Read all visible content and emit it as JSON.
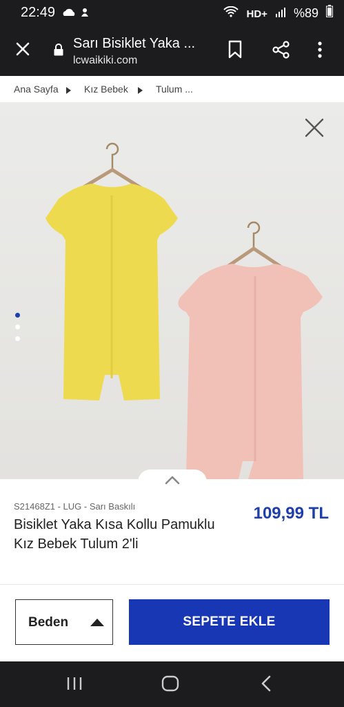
{
  "status_bar": {
    "time": "22:49",
    "network": "HD+",
    "battery": "%89"
  },
  "app_bar": {
    "title": "Sarı Bisiklet Yaka ...",
    "url": "lcwaikiki.com"
  },
  "breadcrumb": {
    "items": [
      "Ana Sayfa",
      "Kız Bebek",
      "Tulum ..."
    ]
  },
  "gallery": {
    "dot_count": 3,
    "active_dot": 0
  },
  "product": {
    "code": "S21468Z1 - LUG - Sarı Baskılı",
    "name": "Bisiklet Yaka Kısa Kollu Pamuklu Kız Bebek Tulum 2'li",
    "price": "109,99 TL"
  },
  "actions": {
    "size_label": "Beden",
    "cart_label": "SEPETE EKLE"
  },
  "colors": {
    "accent": "#1737b4",
    "price": "#1e3eaa",
    "dark_bar": "#1c1c1e"
  }
}
